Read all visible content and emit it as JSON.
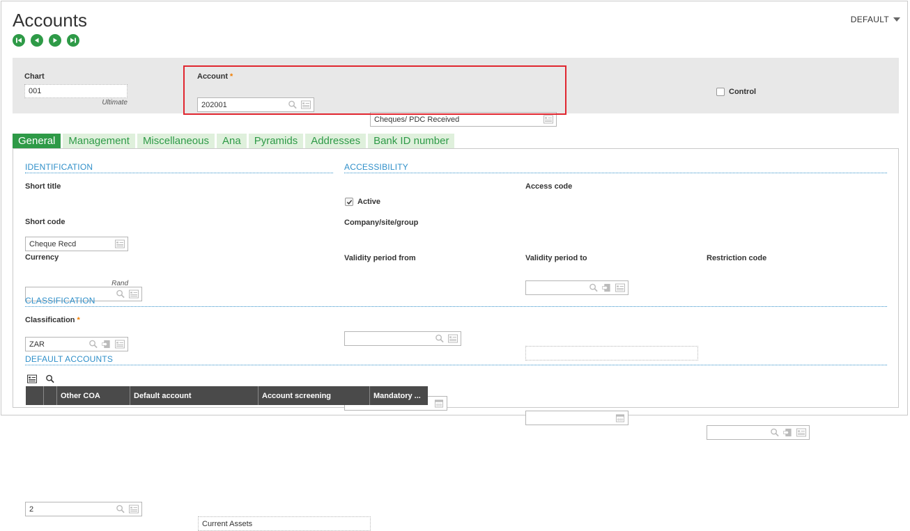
{
  "page": {
    "title": "Accounts",
    "default_menu_label": "DEFAULT"
  },
  "header": {
    "chart": {
      "label": "Chart",
      "value": "001",
      "sub_label": "Ultimate"
    },
    "account": {
      "label": "Account",
      "required_mark": "*",
      "value": "202001",
      "description": "Cheques/ PDC  Received"
    },
    "control": {
      "label": "Control",
      "checked": false
    }
  },
  "tabs": [
    "General",
    "Management",
    "Miscellaneous",
    "Ana",
    "Pyramids",
    "Addresses",
    "Bank ID number"
  ],
  "identification": {
    "section_title": "IDENTIFICATION",
    "short_title": {
      "label": "Short title",
      "value": "Cheque Recd"
    },
    "short_code": {
      "label": "Short code",
      "value": ""
    },
    "currency": {
      "label": "Currency",
      "value": "ZAR",
      "sub_label": "Rand"
    }
  },
  "accessibility": {
    "section_title": "ACCESSIBILITY",
    "active": {
      "label": "Active",
      "checked": true
    },
    "access_code": {
      "label": "Access code",
      "value": ""
    },
    "company_site_group": {
      "label": "Company/site/group",
      "value": ""
    },
    "validity_from": {
      "label": "Validity period from",
      "value": ""
    },
    "validity_to": {
      "label": "Validity period to",
      "value": ""
    },
    "restriction_code": {
      "label": "Restriction code",
      "value": ""
    }
  },
  "classification": {
    "section_title": "CLASSIFICATION",
    "label": "Classification",
    "required_mark": "*",
    "value": "2",
    "description": "Current  Assets"
  },
  "default_accounts": {
    "section_title": "DEFAULT ACCOUNTS",
    "columns": [
      "Other COA",
      "Default account",
      "Account screening",
      "Mandatory ..."
    ]
  },
  "colors": {
    "accent_green": "#2e9a47",
    "tab_inactive_bg": "#dff0dc",
    "section_blue": "#2f8fc9",
    "required_orange": "#f07d00",
    "highlight_red": "#e0262f",
    "grid_header_bg": "#4a4a4a"
  }
}
